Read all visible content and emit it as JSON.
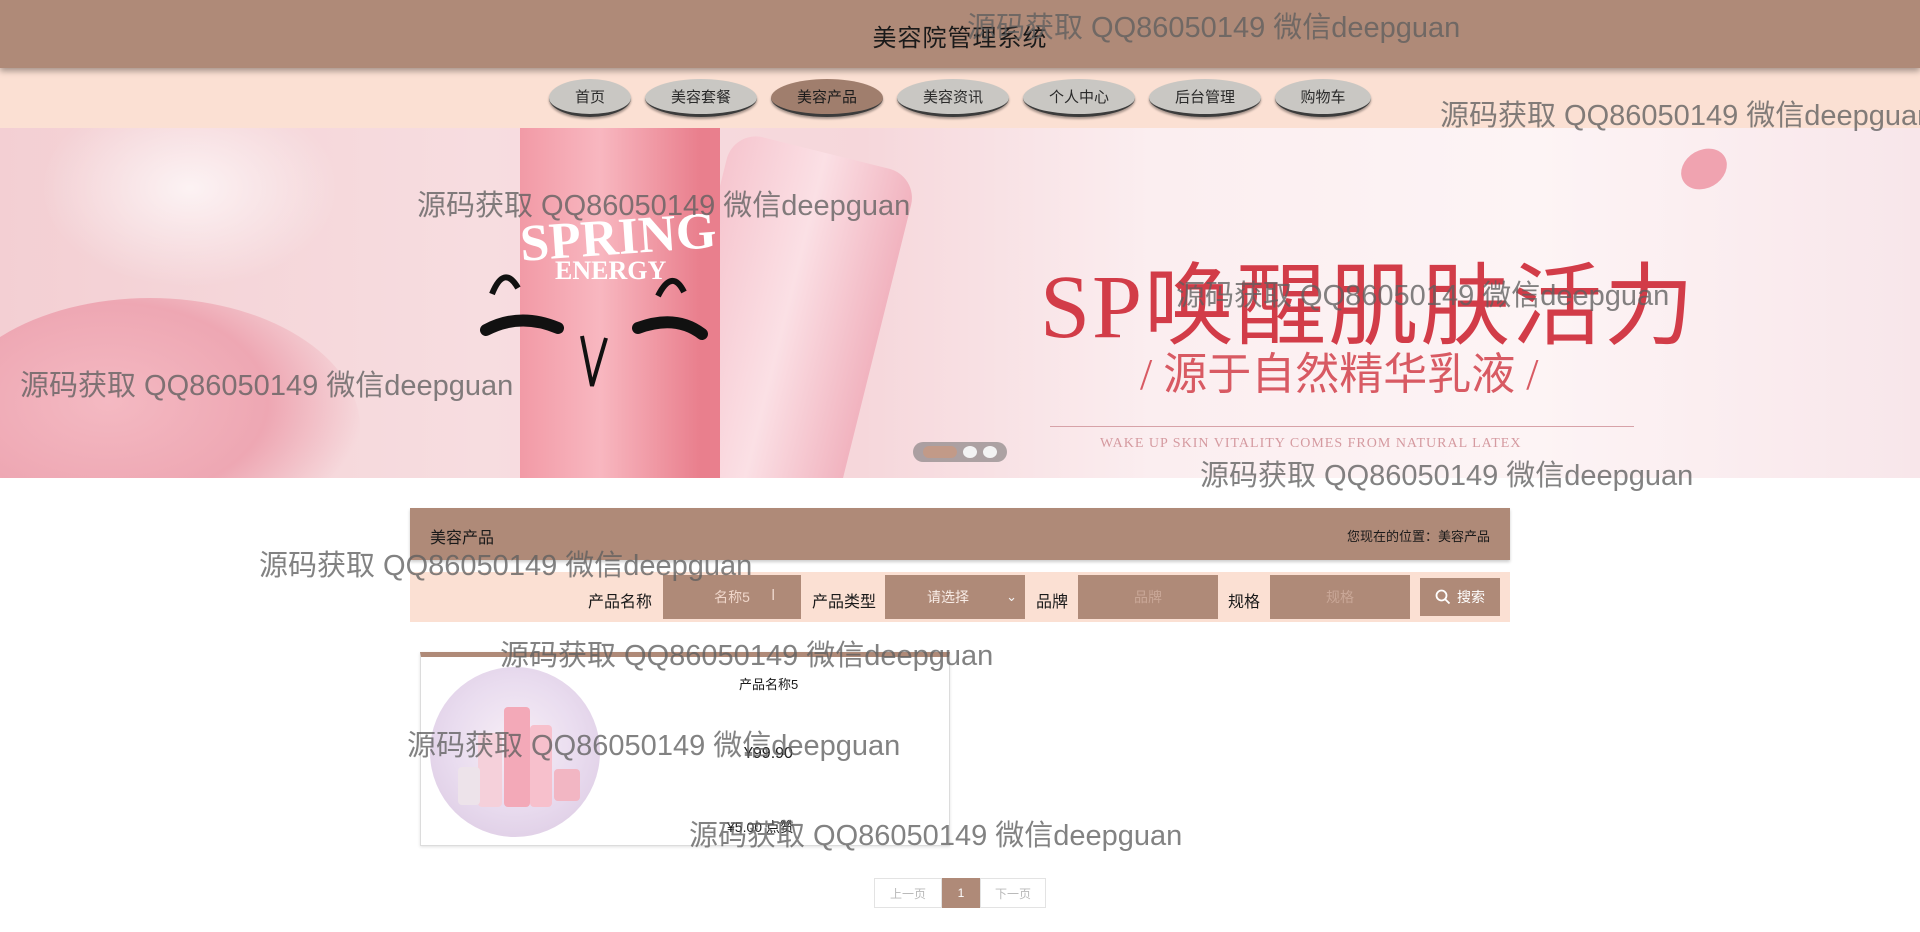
{
  "header": {
    "title": "美容院管理系统"
  },
  "nav": {
    "items": [
      {
        "label": "首页",
        "active": false
      },
      {
        "label": "美容套餐",
        "active": false
      },
      {
        "label": "美容产品",
        "active": true
      },
      {
        "label": "美容资讯",
        "active": false
      },
      {
        "label": "个人中心",
        "active": false
      },
      {
        "label": "后台管理",
        "active": false
      },
      {
        "label": "购物车",
        "active": false
      }
    ]
  },
  "banner": {
    "headline": "SP唤醒肌肤活力",
    "subheadline": "/ 源于自然精华乳液 /",
    "english_tagline": "WAKE UP SKIN VITALITY COMES FROM NATURAL LATEX",
    "brand_line_1": "SPRING",
    "brand_line_2": "ENERGY",
    "carousel_active_index": 0,
    "carousel_count": 3
  },
  "section": {
    "title": "美容产品",
    "breadcrumb": "您现在的位置：美容产品"
  },
  "search": {
    "name_label": "产品名称",
    "name_placeholder": "名称5",
    "type_label": "产品类型",
    "type_selected": "请选择",
    "brand_label": "品牌",
    "brand_placeholder": "品牌",
    "spec_label": "规格",
    "spec_placeholder": "规格",
    "button_label": "搜索"
  },
  "products": [
    {
      "name": "产品名称5",
      "price": "¥99.90",
      "meta": "¥5.00 点赞"
    }
  ],
  "pagination": {
    "prev": "上一页",
    "current": "1",
    "next": "下一页"
  },
  "watermark": {
    "text": "源码获取 QQ86050149 微信deepguan"
  },
  "colors": {
    "primary": "#af8a78",
    "nav_bg": "#fbe0d3",
    "accent": "#d23c48"
  }
}
